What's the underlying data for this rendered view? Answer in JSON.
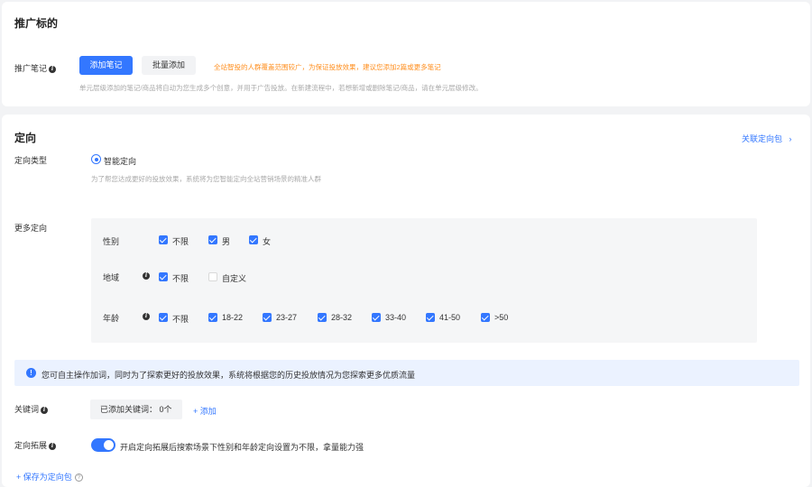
{
  "promo": {
    "title": "推广标的",
    "notes_label": "推广笔记",
    "add_note_button": "添加笔记",
    "batch_add_button": "批量添加",
    "warning": "全站智投的人群覆盖范围较广，为保证投放效果，建议您添加2篇或更多笔记",
    "hint": "单元层级添加的笔记/商品将自动为您生成多个创意，并用于广告投放。在新建流程中，若想新增或删除笔记/商品，请在单元层级修改。"
  },
  "targeting": {
    "title": "定向",
    "linked_package_link": "关联定向包",
    "type_label": "定向类型",
    "smart_option": "智能定向",
    "smart_hint": "为了帮您达成更好的投放效果，系统将为您智能定向全站营销场景的精准人群",
    "more_label": "更多定向",
    "gender": {
      "label": "性别",
      "options": [
        {
          "label": "不限",
          "checked": true
        },
        {
          "label": "男",
          "checked": true
        },
        {
          "label": "女",
          "checked": true
        }
      ]
    },
    "region": {
      "label": "地域",
      "options": [
        {
          "label": "不限",
          "checked": true
        },
        {
          "label": "自定义",
          "checked": false
        }
      ]
    },
    "age": {
      "label": "年龄",
      "options": [
        {
          "label": "不限",
          "checked": true
        },
        {
          "label": "18-22",
          "checked": true
        },
        {
          "label": "23-27",
          "checked": true
        },
        {
          "label": "28-32",
          "checked": true
        },
        {
          "label": "33-40",
          "checked": true
        },
        {
          "label": "41-50",
          "checked": true
        },
        {
          "label": ">50",
          "checked": true
        }
      ]
    }
  },
  "notice": {
    "text": "您可自主操作加词，同时为了探索更好的投放效果，系统将根据您的历史投放情况为您探索更多优质流量"
  },
  "keywords": {
    "label": "关键词",
    "added_text": "已添加关键词： 0个",
    "add_link": "+ 添加"
  },
  "expansion": {
    "label": "定向拓展",
    "enabled": true,
    "description": "开启定向拓展后搜索场景下性别和年龄定向设置为不限，拿量能力强"
  },
  "save_package_link": "+ 保存为定向包",
  "colors": {
    "primary": "#3377ff",
    "warning": "#ff8f1f",
    "notice_bg": "#ebf2ff"
  }
}
